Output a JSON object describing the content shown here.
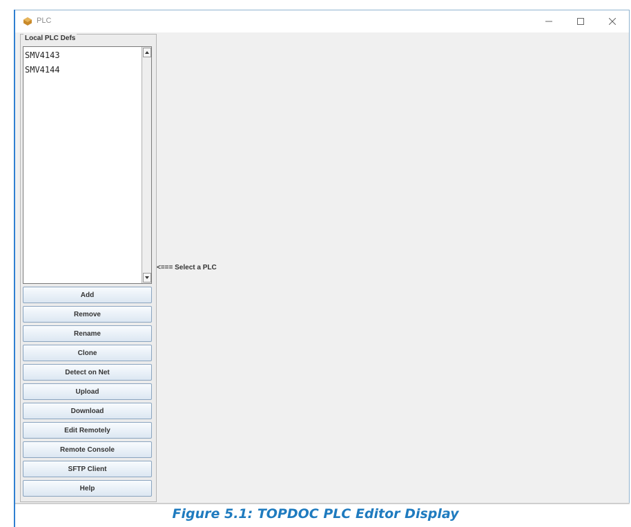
{
  "window": {
    "title": "PLC"
  },
  "panel": {
    "title": "Local PLC Defs",
    "items": [
      "SMV4143",
      "SMV4144"
    ],
    "buttons": [
      "Add",
      "Remove",
      "Rename",
      "Clone",
      "Detect on Net",
      "Upload",
      "Download",
      "Edit Remotely",
      "Remote Console",
      "SFTP Client",
      "Help"
    ]
  },
  "main": {
    "hint": "<=== Select a PLC"
  },
  "caption": "Figure 5.1: TOPDOC PLC Editor Display",
  "colors": {
    "accent": "#2f7fd1",
    "caption": "#1f7bbf",
    "button_top": "#f8fbfe",
    "button_bottom": "#dce7f2"
  }
}
